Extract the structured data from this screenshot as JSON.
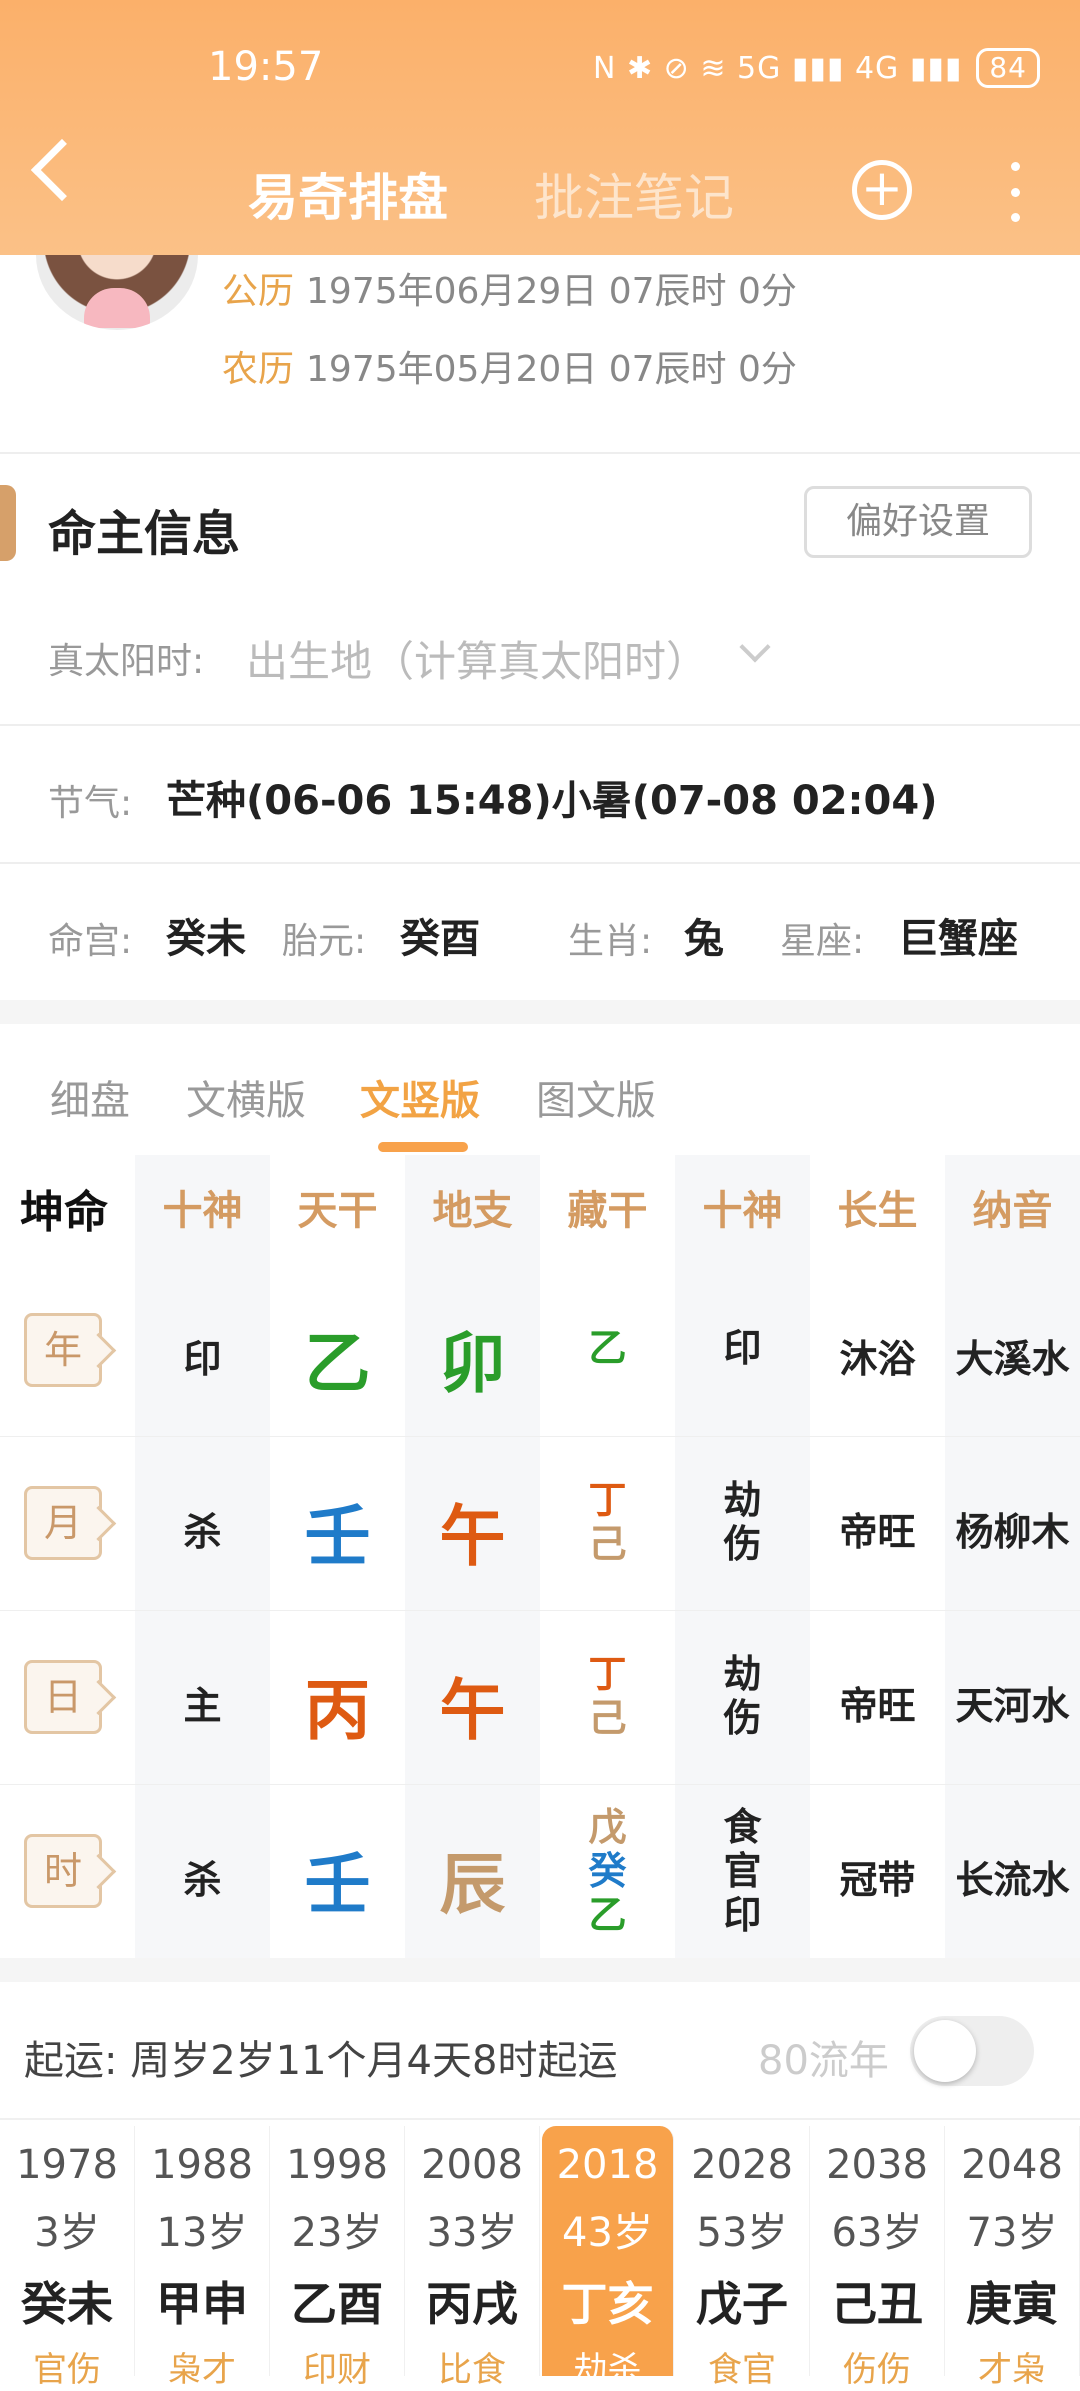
{
  "status": {
    "time": "19:57",
    "icons": "N ✱ ⊘ ≋ 5G ▮▮▮ 4G ▮▮▮",
    "battery": "84"
  },
  "nav": {
    "tab_active": "易奇排盘",
    "tab_inactive": "批注笔记",
    "add_icon": "plus-circle-icon",
    "more_icon": "more-vertical-icon"
  },
  "person": {
    "solar_label": "公历",
    "solar_date": "1975年06月29日 07辰时 0分",
    "lunar_label": "农历",
    "lunar_date": "1975年05月20日 07辰时 0分"
  },
  "info": {
    "title": "命主信息",
    "pref_button": "偏好设置",
    "true_sun_label": "真太阳时:",
    "true_sun_placeholder": "出生地（计算真太阳时）",
    "jieqi_label": "节气:",
    "jieqi_value": "芒种(06-06 15:48)小暑(07-08 02:04)",
    "minggong_label": "命宫:",
    "minggong_value": "癸未",
    "taiyuan_label": "胎元:",
    "taiyuan_value": "癸酉",
    "shengxiao_label": "生肖:",
    "shengxiao_value": "兔",
    "xingzuo_label": "星座:",
    "xingzuo_value": "巨蟹座"
  },
  "view_tabs": [
    "细盘",
    "文横版",
    "文竖版",
    "图文版"
  ],
  "active_tab": "文竖版",
  "chart": {
    "corner": "坤命",
    "headers": [
      "十神",
      "天干",
      "地支",
      "藏干",
      "十神",
      "长生",
      "纳音"
    ],
    "rows": [
      {
        "pillar": "年",
        "shishen": "印",
        "gan": "乙",
        "zhi": "卯",
        "cang": [
          "乙"
        ],
        "cang_shishen": [
          "印"
        ],
        "changsheng": "沐浴",
        "nayin": "大溪水"
      },
      {
        "pillar": "月",
        "shishen": "杀",
        "gan": "壬",
        "zhi": "午",
        "cang": [
          "丁",
          "己"
        ],
        "cang_shishen": [
          "劫",
          "伤"
        ],
        "changsheng": "帝旺",
        "nayin": "杨柳木"
      },
      {
        "pillar": "日",
        "shishen": "主",
        "gan": "丙",
        "zhi": "午",
        "cang": [
          "丁",
          "己"
        ],
        "cang_shishen": [
          "劫",
          "伤"
        ],
        "changsheng": "帝旺",
        "nayin": "天河水"
      },
      {
        "pillar": "时",
        "shishen": "杀",
        "gan": "壬",
        "zhi": "辰",
        "cang": [
          "戊",
          "癸",
          "乙"
        ],
        "cang_shishen": [
          "食",
          "官",
          "印"
        ],
        "changsheng": "冠带",
        "nayin": "长流水"
      }
    ]
  },
  "qiyun": {
    "label": "起运:",
    "text": "周岁2岁11个月4天8时起运",
    "liunian_label": "80流年"
  },
  "dayun": [
    {
      "year": "1978",
      "age": "3岁",
      "gz": "癸未",
      "tag": "官伤"
    },
    {
      "year": "1988",
      "age": "13岁",
      "gz": "甲申",
      "tag": "枭才"
    },
    {
      "year": "1998",
      "age": "23岁",
      "gz": "乙酉",
      "tag": "印财"
    },
    {
      "year": "2008",
      "age": "33岁",
      "gz": "丙戌",
      "tag": "比食"
    },
    {
      "year": "2018",
      "age": "43岁",
      "gz": "丁亥",
      "tag": "劫杀"
    },
    {
      "year": "2028",
      "age": "53岁",
      "gz": "戊子",
      "tag": "食官"
    },
    {
      "year": "2038",
      "age": "63岁",
      "gz": "己丑",
      "tag": "伤伤"
    },
    {
      "year": "2048",
      "age": "73岁",
      "gz": "庚寅",
      "tag": "才枭"
    }
  ]
}
